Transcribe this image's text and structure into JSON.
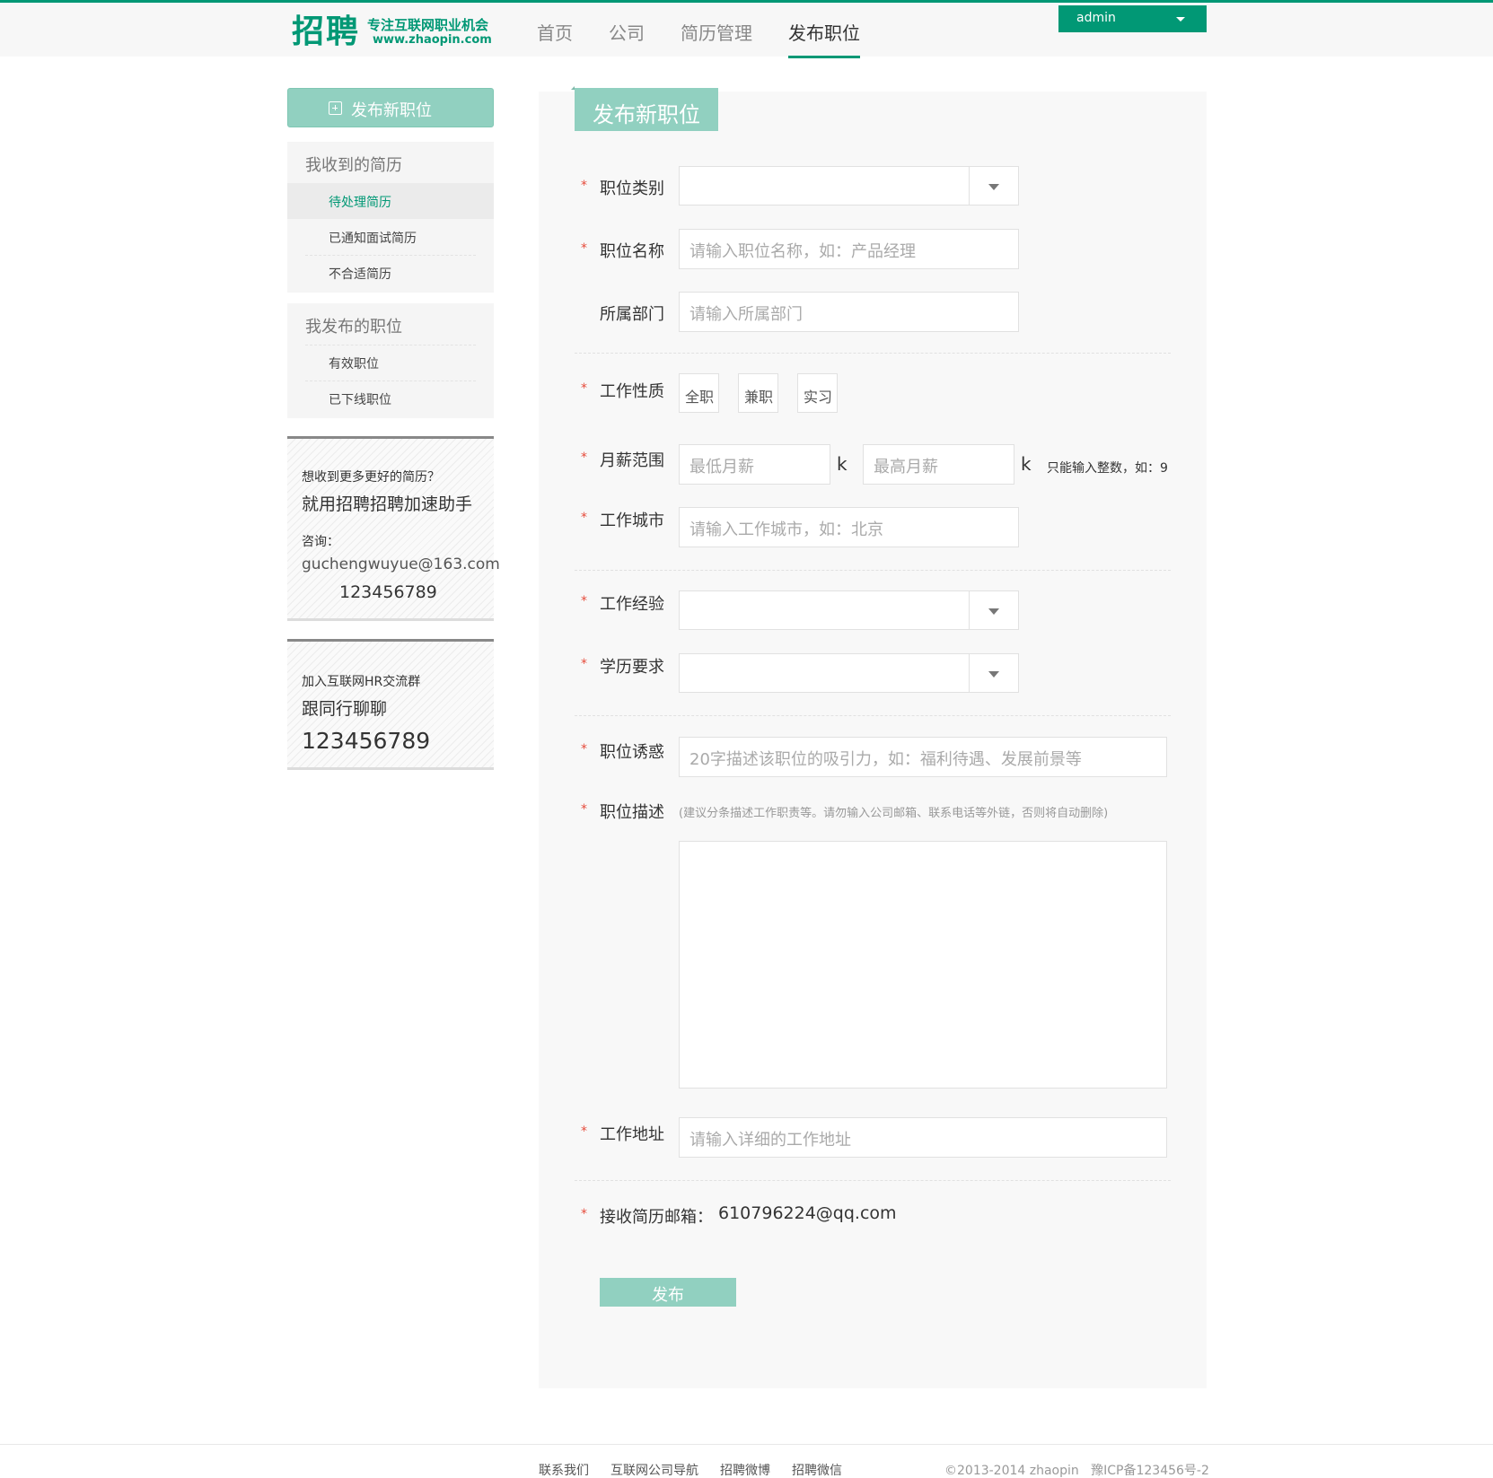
{
  "header": {
    "logo_main": "招聘",
    "logo_slogan": "专注互联网职业机会",
    "logo_url": "www.zhaopin.com",
    "nav": [
      {
        "label": "首页"
      },
      {
        "label": "公司"
      },
      {
        "label": "简历管理"
      },
      {
        "label": "发布职位"
      }
    ],
    "user": "admin",
    "accent": "#019875"
  },
  "sidebar": {
    "publish_button": "发布新职位",
    "resumes": {
      "title": "我收到的简历",
      "items": [
        {
          "label": "待处理简历"
        },
        {
          "label": "已通知面试简历"
        },
        {
          "label": "不合适简历"
        }
      ]
    },
    "jobs": {
      "title": "我发布的职位",
      "items": [
        {
          "label": "有效职位"
        },
        {
          "label": "已下线职位"
        }
      ]
    },
    "promo1": {
      "line1": "想收到更多更好的简历？",
      "line2": "就用招聘招聘加速助手",
      "line3": "咨询：",
      "email": "guchengwuyue@163.com",
      "phone": "123456789"
    },
    "promo2": {
      "line1": "加入互联网HR交流群",
      "line2": "跟同行聊聊",
      "number": "123456789"
    }
  },
  "form": {
    "title": "发布新职位",
    "category_label": "职位类别",
    "name_label": "职位名称",
    "name_placeholder": "请输入职位名称，如：产品经理",
    "dept_label": "所属部门",
    "dept_placeholder": "请输入所属部门",
    "type_label": "工作性质",
    "type_options": [
      "全职",
      "兼职",
      "实习"
    ],
    "salary_label": "月薪范围",
    "salary_min_placeholder": "最低月薪",
    "salary_max_placeholder": "最高月薪",
    "salary_unit": "k",
    "salary_hint": "只能输入整数，如：9",
    "city_label": "工作城市",
    "city_placeholder": "请输入工作城市，如：北京",
    "exp_label": "工作经验",
    "edu_label": "学历要求",
    "lure_label": "职位诱惑",
    "lure_placeholder": "20字描述该职位的吸引力，如：福利待遇、发展前景等",
    "desc_label": "职位描述",
    "desc_hint": "(建议分条描述工作职责等。请勿输入公司邮箱、联系电话等外链，否则将自动删除)",
    "address_label": "工作地址",
    "address_placeholder": "请输入详细的工作地址",
    "email_label": "接收简历邮箱：",
    "email_value": "610796224@qq.com",
    "required_mark": "*",
    "submit": "发布"
  },
  "footer": {
    "links": [
      {
        "label": "联系我们"
      },
      {
        "label": "互联网公司导航"
      },
      {
        "label": "招聘微博"
      },
      {
        "label": "招聘微信"
      }
    ],
    "copyright": "©2013-2014 zhaopin",
    "icp": "豫ICP备123456号-2"
  }
}
